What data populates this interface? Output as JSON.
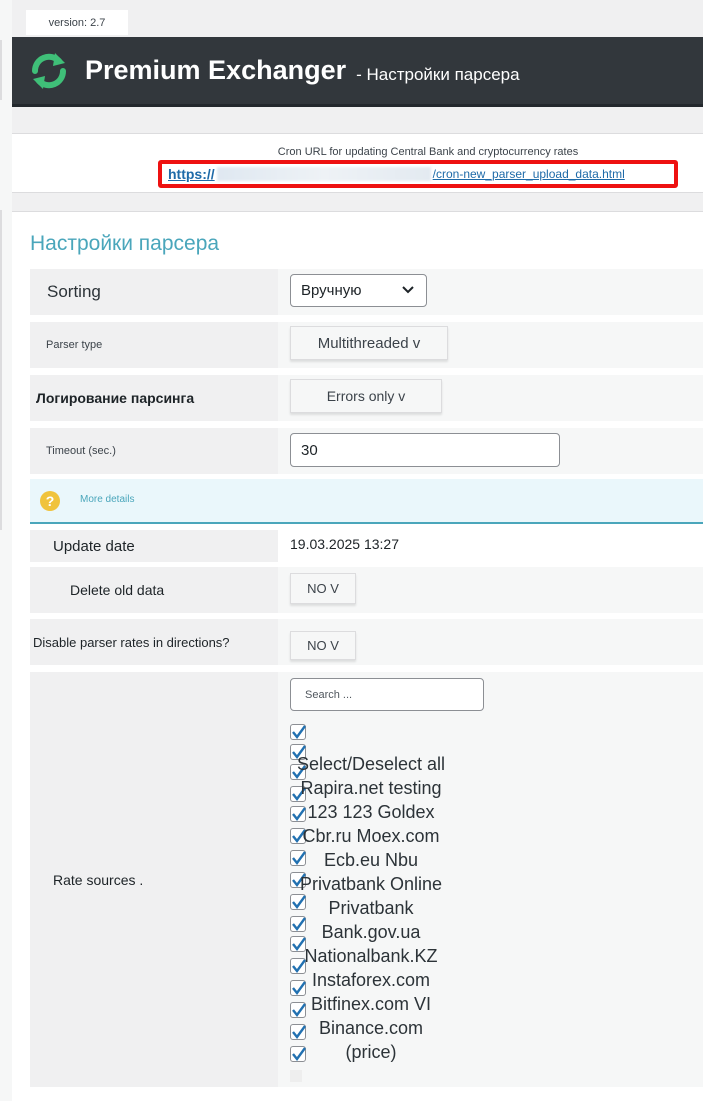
{
  "version": "version: 2.7",
  "header": {
    "brand": "Premium Exchanger",
    "subtitle": "- Настройки парсера",
    "accent_color": "#32373c"
  },
  "cron": {
    "label": "Cron URL for updating Central Bank and cryptocurrency rates",
    "url_protocol": "https://",
    "url_path": "/cron-new_parser_upload_data.html"
  },
  "panel": {
    "title": "Настройки парсера",
    "sorting": {
      "label": "Sorting",
      "value": "Вручную"
    },
    "parser_type": {
      "label": "Parser type",
      "value": "Multithreaded v"
    },
    "logging": {
      "label": "Логирование парсинга",
      "value": "Errors only v"
    },
    "timeout": {
      "label": "Timeout (sec.)",
      "value": "30"
    },
    "more_details": "More details",
    "update_date": {
      "label": "Update date",
      "value": "19.03.2025 13:27"
    },
    "delete_old": {
      "label": "Delete old data",
      "value": "NO V"
    },
    "disable_rates": {
      "label": "Disable parser rates in directions?",
      "value": "NO V"
    },
    "rate_sources": {
      "label": "Rate sources .",
      "search_placeholder": "Search ...",
      "lines": [
        "Select/Deselect all",
        "Rapira.net testing",
        "123 123 Goldex",
        "Cbr.ru Moex.com",
        "Ecb.eu Nbu",
        "Privatbank Online",
        "Privatbank",
        "Bank.gov.ua",
        "Nationalbank.KZ",
        "Instaforex.com",
        "Bitfinex.com VI",
        "Binance.com",
        "(price)"
      ]
    }
  },
  "colors": {
    "title": "#4aa6bb",
    "link": "#1e6aa8",
    "highlight_border": "#ee1111",
    "checkmark": "#2271b1"
  }
}
